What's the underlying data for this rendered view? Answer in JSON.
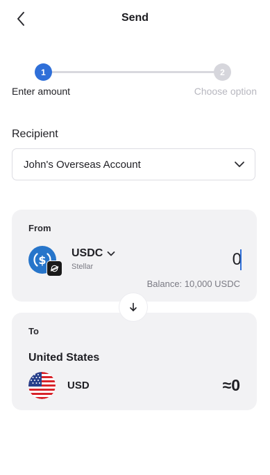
{
  "header": {
    "title": "Send",
    "back_icon": "chevron-left-icon"
  },
  "stepper": {
    "steps": [
      {
        "number": "1",
        "label": "Enter amount",
        "state": "active"
      },
      {
        "number": "2",
        "label": "Choose option",
        "state": "inactive"
      }
    ]
  },
  "recipient": {
    "label": "Recipient",
    "selected": "John's Overseas Account",
    "icon": "chevron-down-icon"
  },
  "from": {
    "title": "From",
    "token": "USDC",
    "network": "Stellar",
    "amount": "0",
    "balance": "Balance: 10,000 USDC",
    "token_icon": "usdc-icon",
    "network_icon": "stellar-icon"
  },
  "swap": {
    "icon": "arrow-down-icon"
  },
  "to": {
    "title": "To",
    "country": "United States",
    "currency": "USD",
    "converted_amount": "≈0",
    "flag_icon": "us-flag-icon"
  },
  "colors": {
    "accent": "#2f6fd8",
    "card_bg": "#f2f2f4",
    "usdc_blue": "#2775ca",
    "muted": "#b7b7bf"
  }
}
